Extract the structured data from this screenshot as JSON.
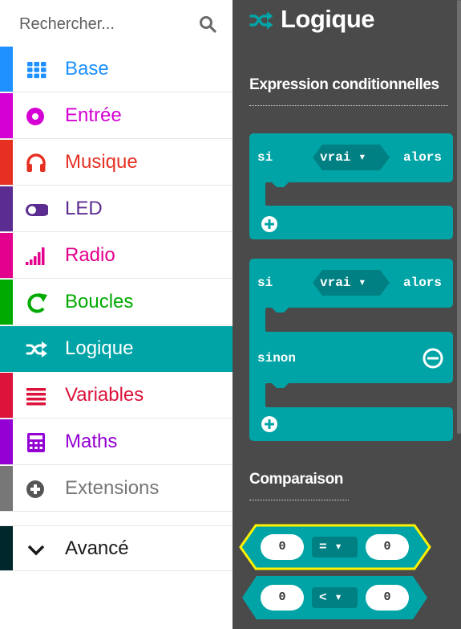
{
  "search": {
    "placeholder": "Rechercher..."
  },
  "toolbox": {
    "categories": [
      {
        "label": "Base",
        "color": "#1e90ff",
        "icon": "grid-icon"
      },
      {
        "label": "Entrée",
        "color": "#d400d4",
        "icon": "circle-dot-icon"
      },
      {
        "label": "Musique",
        "color": "#e63022",
        "icon": "headphones-icon"
      },
      {
        "label": "LED",
        "color": "#5c2d91",
        "icon": "toggle-icon"
      },
      {
        "label": "Radio",
        "color": "#e3008c",
        "icon": "signal-bars-icon"
      },
      {
        "label": "Boucles",
        "color": "#00aa00",
        "icon": "loop-arrow-icon"
      },
      {
        "label": "Logique",
        "color": "#00a4a6",
        "icon": "shuffle-icon",
        "selected": true
      },
      {
        "label": "Variables",
        "color": "#dc143c",
        "icon": "lines-icon"
      },
      {
        "label": "Maths",
        "color": "#9400d3",
        "icon": "calculator-icon"
      },
      {
        "label": "Extensions",
        "color": "#777777",
        "icon": "plus-circle-icon"
      }
    ],
    "advanced": {
      "label": "Avancé",
      "color": "#00272b",
      "icon": "chevron-down-icon"
    }
  },
  "flyout": {
    "title": "Logique",
    "sections": [
      {
        "heading": "Expression conditionnelles"
      },
      {
        "heading": "Comparaison"
      }
    ],
    "blocks": {
      "if_then": {
        "si": "si",
        "value": "vrai ▾",
        "alors": "alors"
      },
      "if_else": {
        "si": "si",
        "value": "vrai ▾",
        "alors": "alors",
        "sinon": "sinon"
      },
      "compare_eq": {
        "left": "0",
        "op": "= ▾",
        "right": "0"
      },
      "compare_lt": {
        "left": "0",
        "op": "< ▾",
        "right": "0"
      }
    },
    "block_color": "#00a4a6",
    "block_dark": "#008083",
    "highlight_color": "#fff200"
  }
}
